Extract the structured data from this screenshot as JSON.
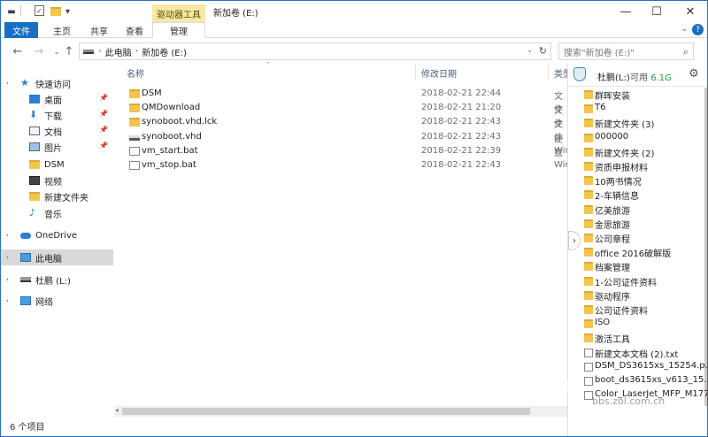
{
  "window": {
    "title": "新加卷 (E:)",
    "contextual_tab_group": "驱动器工具",
    "controls": {
      "minimize": "—",
      "maximize": "☐",
      "close": "✕"
    }
  },
  "quick_access_toolbar": {
    "dropdown": "▾"
  },
  "ribbon": {
    "tabs": [
      "文件",
      "主页",
      "共享",
      "查看",
      "管理"
    ],
    "expand": "⌄",
    "help": "?"
  },
  "address_bar": {
    "crumbs": [
      "此电脑",
      "新加卷 (E:)"
    ],
    "search_placeholder": "搜索\"新加卷 (E:)\""
  },
  "nav_pane": {
    "items": [
      {
        "label": "快速访问",
        "icon": "star-icon"
      },
      {
        "label": "桌面",
        "icon": "desktop-icon",
        "pinned": true
      },
      {
        "label": "下载",
        "icon": "download-icon",
        "pinned": true
      },
      {
        "label": "文档",
        "icon": "documents-icon",
        "pinned": true
      },
      {
        "label": "图片",
        "icon": "pictures-icon",
        "pinned": true
      },
      {
        "label": "DSM",
        "icon": "folder-icon"
      },
      {
        "label": "视频",
        "icon": "video-icon"
      },
      {
        "label": "新建文件夹",
        "icon": "folder-icon"
      },
      {
        "label": "音乐",
        "icon": "music-icon"
      },
      {
        "label": "OneDrive",
        "icon": "cloud-icon"
      },
      {
        "label": "此电脑",
        "icon": "computer-icon",
        "selected": true
      },
      {
        "label": "杜鹏 (L:)",
        "icon": "drive-icon"
      },
      {
        "label": "网络",
        "icon": "network-icon"
      }
    ]
  },
  "columns": {
    "name": "名称",
    "date": "修改日期",
    "type": "类型"
  },
  "files": [
    {
      "name": "DSM",
      "date": "2018-02-21 22:44",
      "type": "文件",
      "icon": "folder-icon"
    },
    {
      "name": "QMDownload",
      "date": "2018-02-21 21:20",
      "type": "文件",
      "icon": "folder-icon"
    },
    {
      "name": "synoboot.vhd.lck",
      "date": "2018-02-21 22:43",
      "type": "文件",
      "icon": "folder-icon"
    },
    {
      "name": "synoboot.vhd",
      "date": "2018-02-21 22:43",
      "type": "硬盘",
      "icon": "drive-icon"
    },
    {
      "name": "vm_start.bat",
      "date": "2018-02-21 22:39",
      "type": "Win",
      "icon": "batch-file-icon"
    },
    {
      "name": "vm_stop.bat",
      "date": "2018-02-21 22:43",
      "type": "Win",
      "icon": "batch-file-icon"
    }
  ],
  "status_bar": {
    "count": "6 个项目"
  },
  "drive_panel": {
    "drive": "杜鹏(L:)",
    "available_label": "可用",
    "available_value": "6.1G",
    "items": [
      {
        "name": "群晖安装",
        "icon": "folder-icon"
      },
      {
        "name": "T6",
        "icon": "folder-icon"
      },
      {
        "name": "新建文件夹 (3)",
        "icon": "folder-icon"
      },
      {
        "name": "000000",
        "icon": "folder-icon"
      },
      {
        "name": "新建文件夹 (2)",
        "icon": "folder-icon"
      },
      {
        "name": "资质申报材料",
        "icon": "folder-icon"
      },
      {
        "name": "10两书情况",
        "icon": "folder-icon"
      },
      {
        "name": "2-车辆信息",
        "icon": "folder-icon"
      },
      {
        "name": "亿美旅游",
        "icon": "folder-icon"
      },
      {
        "name": "金思旅游",
        "icon": "folder-icon"
      },
      {
        "name": "公司章程",
        "icon": "folder-icon"
      },
      {
        "name": "office 2016破解版",
        "icon": "folder-icon"
      },
      {
        "name": "档案管理",
        "icon": "folder-icon"
      },
      {
        "name": "1-公司证件资料",
        "icon": "folder-icon"
      },
      {
        "name": "驱动程序",
        "icon": "folder-icon"
      },
      {
        "name": "公司证件资料",
        "icon": "folder-icon"
      },
      {
        "name": "ISO",
        "icon": "folder-icon"
      },
      {
        "name": "激活工具",
        "icon": "folder-icon"
      },
      {
        "name": "新建文本文档 (2).txt",
        "icon": "text-file-icon"
      },
      {
        "name": "DSM_DS3615xs_15254.p...",
        "icon": "file-icon"
      },
      {
        "name": "boot_ds3615xs_v613_15...",
        "icon": "file-icon"
      },
      {
        "name": "Color_LaserJet_MFP_M177...",
        "icon": "file-icon"
      }
    ]
  },
  "watermark": {
    "text": "ZOL",
    "site": "bbs.zol.com.cn"
  }
}
